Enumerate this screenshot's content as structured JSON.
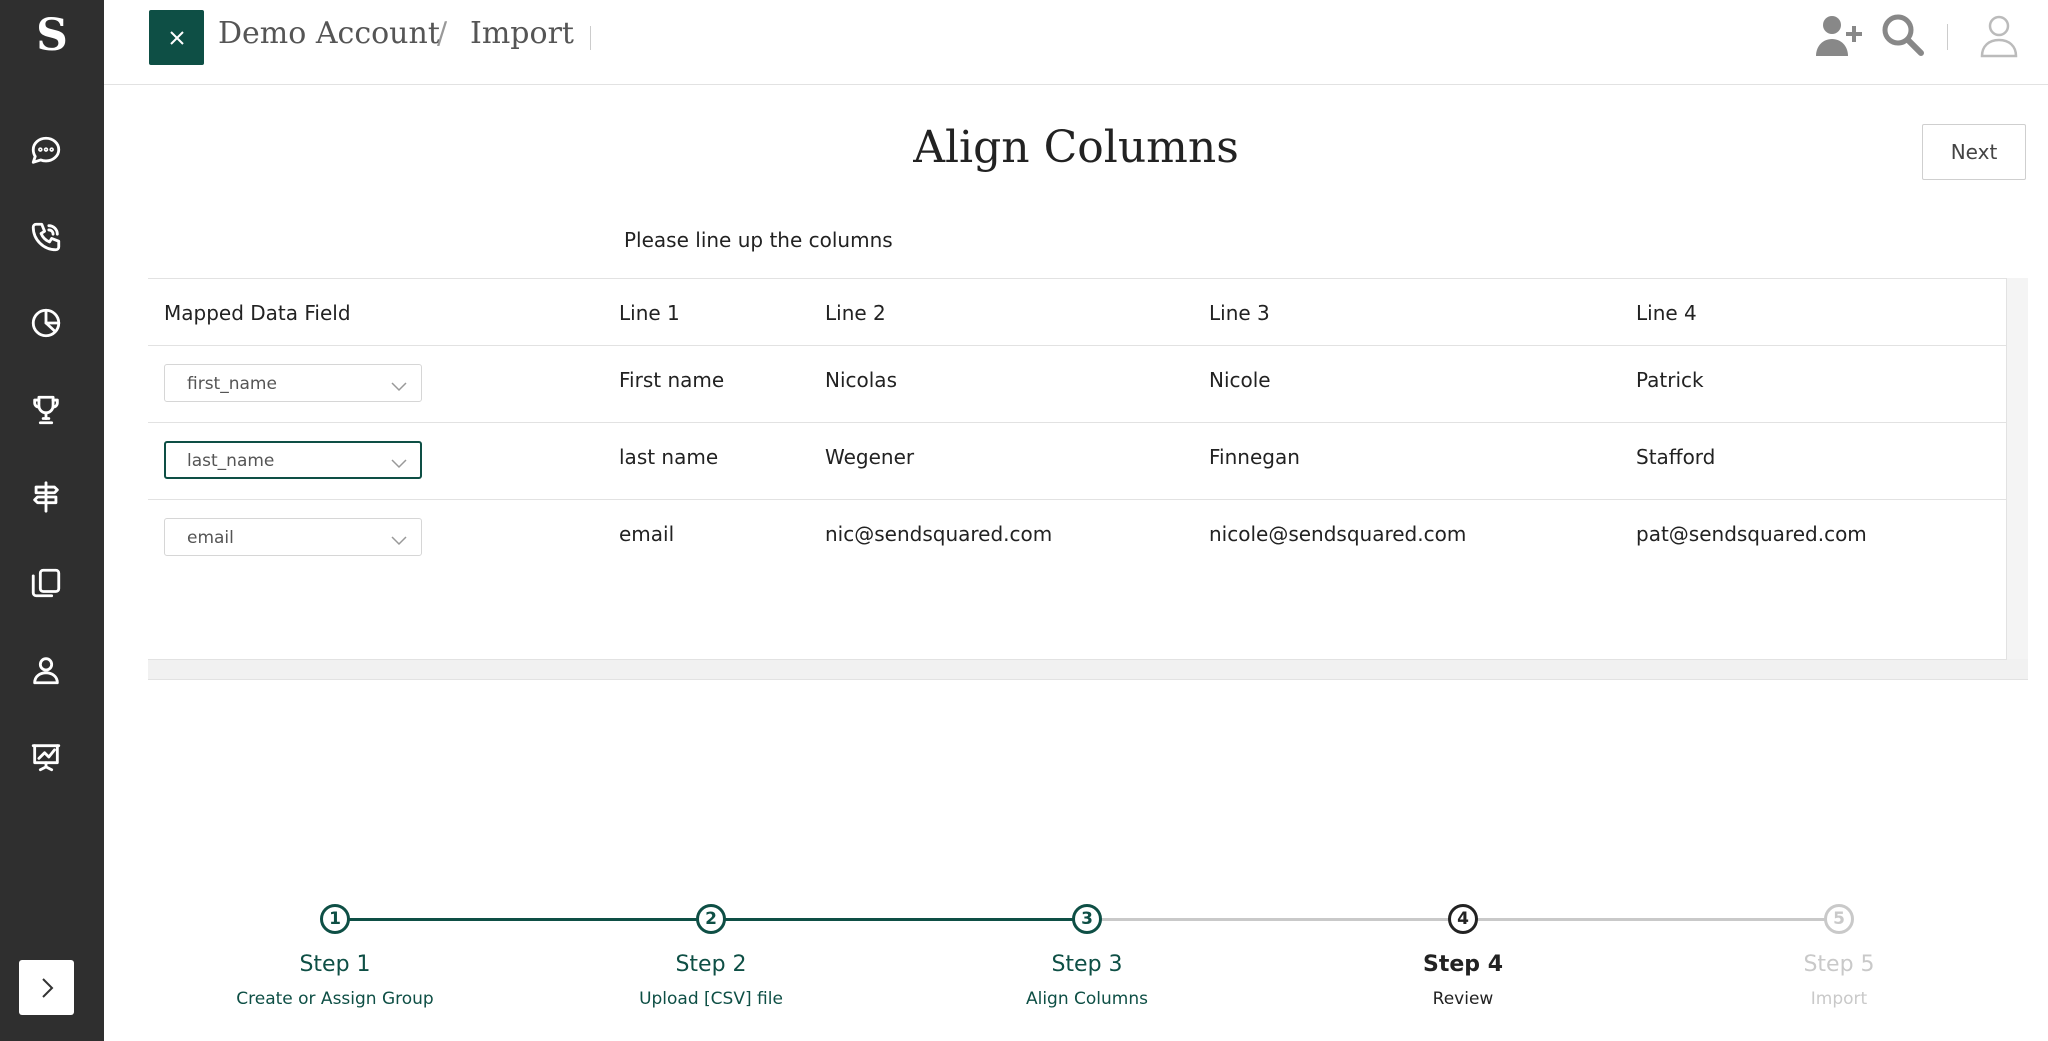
{
  "sidebar": {
    "logo": "S",
    "icons": [
      "chat-icon",
      "phone-icon",
      "pie-chart-icon",
      "trophy-icon",
      "signpost-icon",
      "copy-icon",
      "user-icon",
      "presentation-chart-icon"
    ],
    "expand_icon": "chevron-right-icon"
  },
  "header": {
    "account": "Demo Account",
    "separator": "/",
    "page": "Import",
    "icons": [
      "add-user-icon",
      "search-icon",
      "profile-icon"
    ]
  },
  "main": {
    "title": "Align Columns",
    "next_label": "Next",
    "subtitle": "Please line up the columns"
  },
  "table": {
    "headers": [
      "Mapped Data Field",
      "Line 1",
      "Line 2",
      "Line 3",
      "Line 4"
    ],
    "rows": [
      {
        "field": "first_name",
        "values": [
          "First name",
          "Nicolas",
          "Nicole",
          "Patrick"
        ]
      },
      {
        "field": "last_name",
        "values": [
          "last name",
          "Wegener",
          "Finnegan",
          "Stafford"
        ]
      },
      {
        "field": "email",
        "values": [
          "email",
          "nic@sendsquared.com",
          "nicole@sendsquared.com",
          "pat@sendsquared.com"
        ]
      }
    ]
  },
  "stepper": {
    "steps": [
      {
        "num": "1",
        "label": "Step 1",
        "desc": "Create or Assign Group",
        "state": "done"
      },
      {
        "num": "2",
        "label": "Step 2",
        "desc": "Upload [CSV] file",
        "state": "done"
      },
      {
        "num": "3",
        "label": "Step 3",
        "desc": "Align Columns",
        "state": "done"
      },
      {
        "num": "4",
        "label": "Step 4",
        "desc": "Review",
        "state": "current"
      },
      {
        "num": "5",
        "label": "Step 5",
        "desc": "Import",
        "state": "upcoming"
      }
    ]
  },
  "colors": {
    "sidebar": "#2f2f2f",
    "accent": "#0e4f45",
    "upcoming": "#c9c9c9"
  }
}
